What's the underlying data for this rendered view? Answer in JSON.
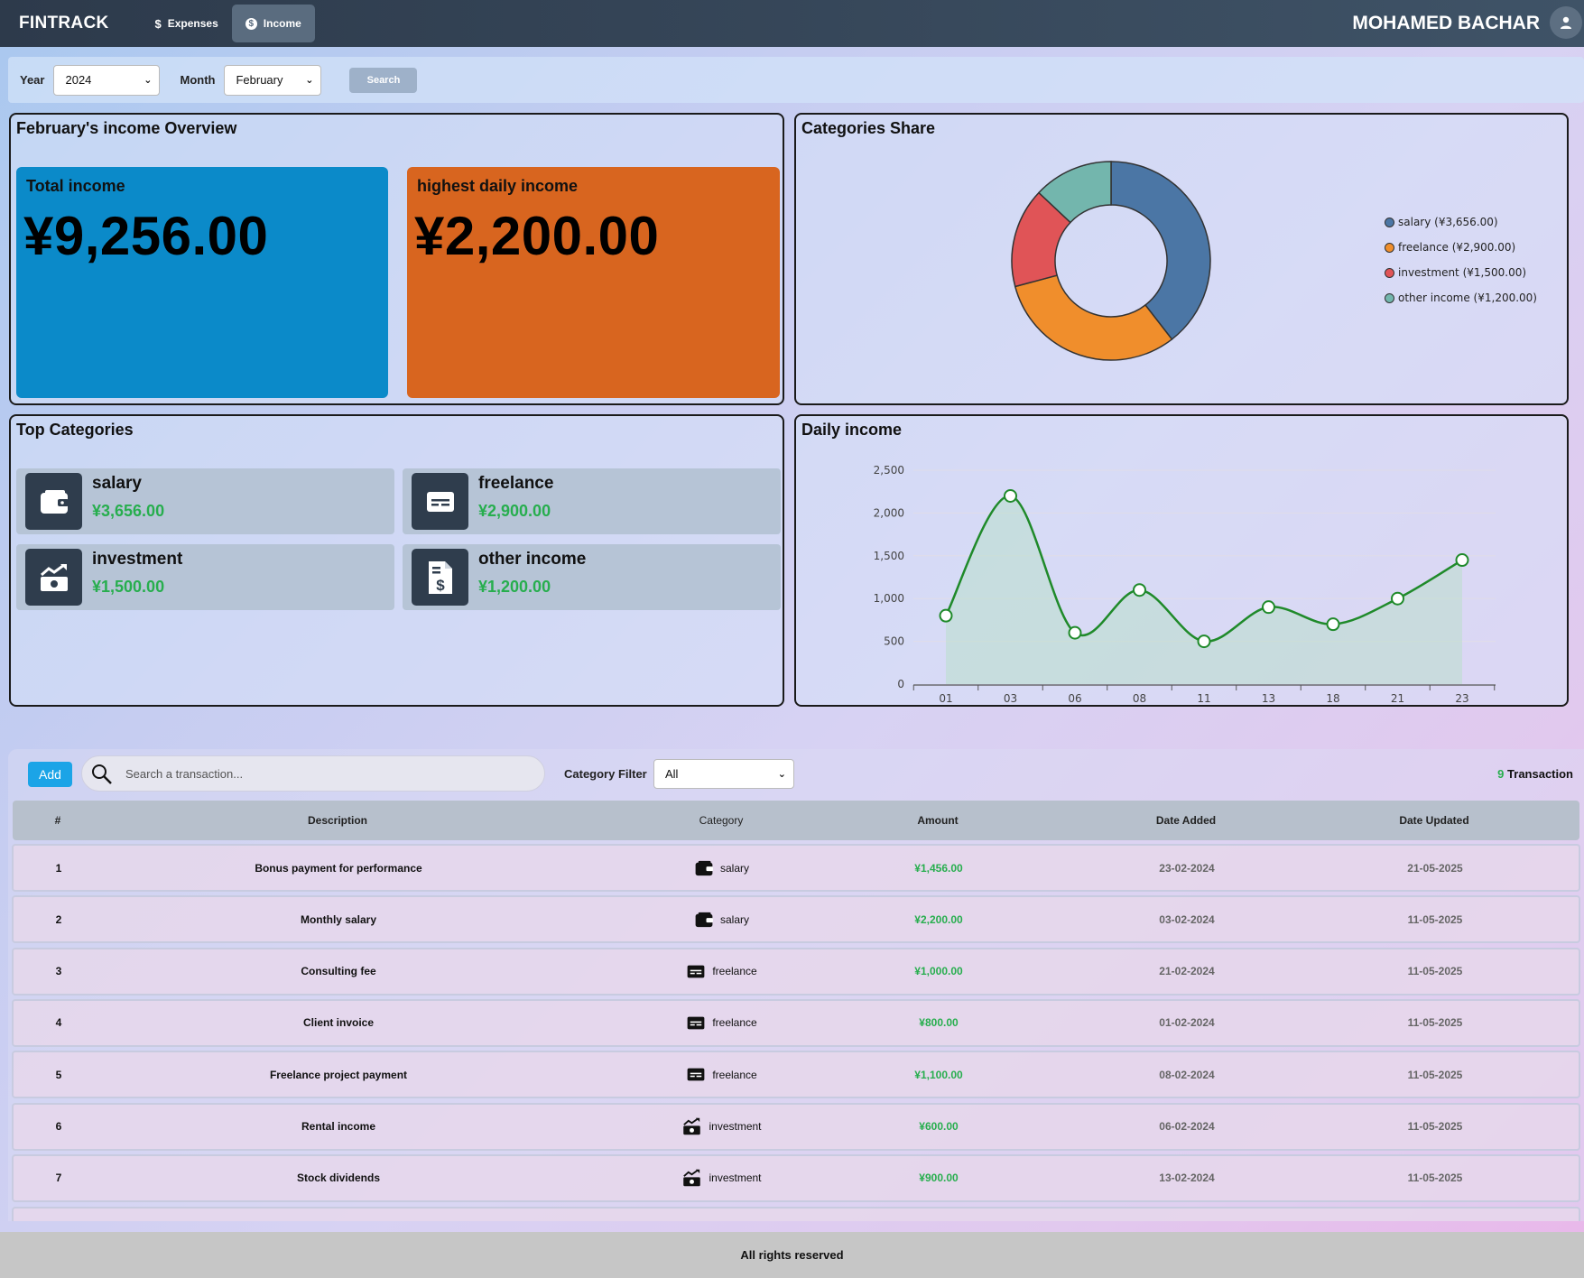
{
  "navbar": {
    "brand": "FINTRACK",
    "links": [
      {
        "label": "Expenses",
        "icon": "dollar-icon"
      },
      {
        "label": "Income",
        "icon": "coin-icon",
        "active": true
      }
    ],
    "user_name": "MOHAMED BACHAR"
  },
  "filters": {
    "year_label": "Year",
    "year_value": "2024",
    "month_label": "Month",
    "month_value": "February",
    "search_label": "Search"
  },
  "overview": {
    "title": "February's income Overview",
    "total_label": "Total income",
    "total_value": "¥9,256.00",
    "total_color": "#0b8ac9",
    "highest_label": "highest daily income",
    "highest_value": "¥2,200.00",
    "highest_color": "#d8651f"
  },
  "categories_share": {
    "title": "Categories Share",
    "chart_data": {
      "type": "pie",
      "categories": [
        "salary",
        "freelance",
        "investment",
        "other income"
      ],
      "values": [
        3656,
        2900,
        1500,
        1200
      ],
      "colors": [
        "#4b76a5",
        "#f08e2c",
        "#e05457",
        "#73b6ad"
      ],
      "legend": [
        "salary (¥3,656.00)",
        "freelance (¥2,900.00)",
        "investment (¥1,500.00)",
        "other income (¥1,200.00)"
      ],
      "legend_position": "right"
    }
  },
  "top_categories": {
    "title": "Top Categories",
    "items": [
      {
        "name": "salary",
        "amount": "¥3,656.00",
        "icon": "wallet-icon"
      },
      {
        "name": "freelance",
        "amount": "¥2,900.00",
        "icon": "card-icon"
      },
      {
        "name": "investment",
        "amount": "¥1,500.00",
        "icon": "investment-icon"
      },
      {
        "name": "other income",
        "amount": "¥1,200.00",
        "icon": "invoice-dollar-icon"
      }
    ]
  },
  "daily_income": {
    "title": "Daily income",
    "chart_data": {
      "type": "area",
      "x": [
        "01",
        "03",
        "06",
        "08",
        "11",
        "13",
        "18",
        "21",
        "23"
      ],
      "values": [
        800,
        2200,
        600,
        1100,
        500,
        900,
        700,
        1000,
        1450
      ],
      "ylim": [
        0,
        2500
      ],
      "y_ticks": [
        "0",
        "500",
        "1,000",
        "1,500",
        "2,000",
        "2,500"
      ],
      "line_color": "#1f8a2a",
      "grid": true,
      "xlabel": "",
      "ylabel": ""
    }
  },
  "transactions": {
    "add_label": "Add",
    "search_placeholder": "Search a transaction...",
    "category_filter_label": "Category Filter",
    "category_filter_value": "All",
    "count": "9",
    "count_label": "Transaction",
    "headers": [
      "#",
      "Description",
      "Category",
      "Amount",
      "Date Added",
      "Date Updated"
    ],
    "rows": [
      {
        "num": "1",
        "desc": "Bonus payment for performance",
        "cat": "salary",
        "icon": "wallet-icon",
        "amount": "¥1,456.00",
        "added": "23-02-2024",
        "updated": "21-05-2025"
      },
      {
        "num": "2",
        "desc": "Monthly salary",
        "cat": "salary",
        "icon": "wallet-icon",
        "amount": "¥2,200.00",
        "added": "03-02-2024",
        "updated": "11-05-2025"
      },
      {
        "num": "3",
        "desc": "Consulting fee",
        "cat": "freelance",
        "icon": "card-icon",
        "amount": "¥1,000.00",
        "added": "21-02-2024",
        "updated": "11-05-2025"
      },
      {
        "num": "4",
        "desc": "Client invoice",
        "cat": "freelance",
        "icon": "card-icon",
        "amount": "¥800.00",
        "added": "01-02-2024",
        "updated": "11-05-2025"
      },
      {
        "num": "5",
        "desc": "Freelance project payment",
        "cat": "freelance",
        "icon": "card-icon",
        "amount": "¥1,100.00",
        "added": "08-02-2024",
        "updated": "11-05-2025"
      },
      {
        "num": "6",
        "desc": "Rental income",
        "cat": "investment",
        "icon": "investment-icon",
        "amount": "¥600.00",
        "added": "06-02-2024",
        "updated": "11-05-2025"
      },
      {
        "num": "7",
        "desc": "Stock dividends",
        "cat": "investment",
        "icon": "investment-icon",
        "amount": "¥900.00",
        "added": "13-02-2024",
        "updated": "11-05-2025"
      }
    ]
  },
  "footer": {
    "text": "All rights reserved"
  }
}
